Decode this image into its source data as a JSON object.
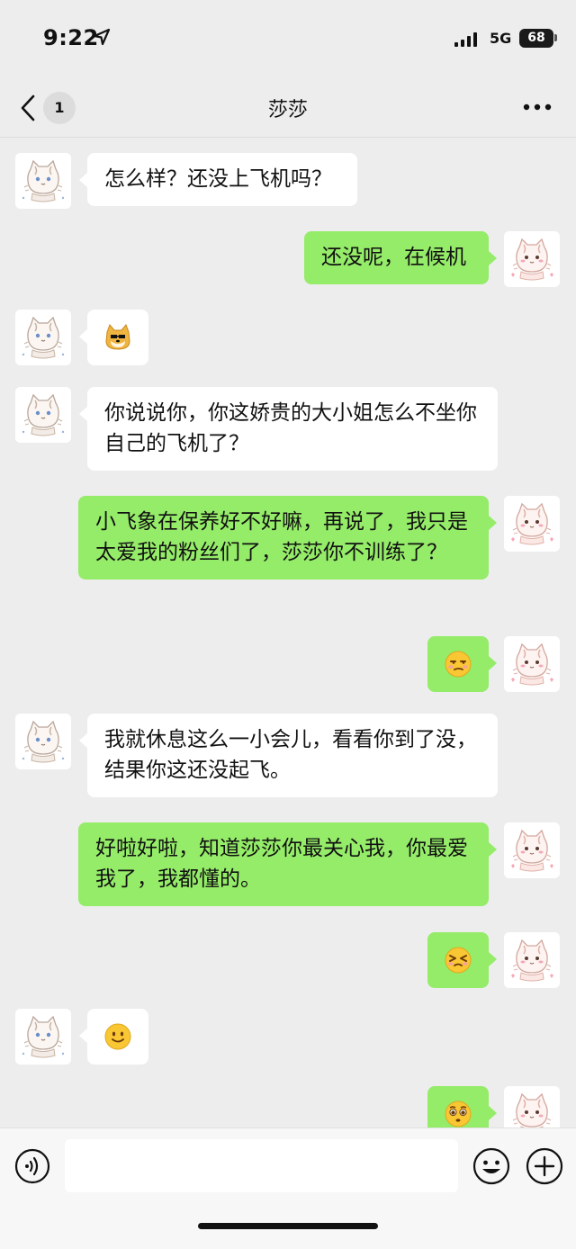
{
  "status_bar": {
    "time": "9:22",
    "network": "5G",
    "battery": "68"
  },
  "nav": {
    "unread_badge": "1",
    "title": "莎莎"
  },
  "messages": [
    {
      "side": "left",
      "type": "text",
      "text": "怎么样？还没上飞机吗？"
    },
    {
      "side": "right",
      "type": "text",
      "text": "还没呢，在候机"
    },
    {
      "side": "left",
      "type": "emoji",
      "emoji": "doge-emoji"
    },
    {
      "side": "left",
      "type": "text",
      "text": "你说说你，你这娇贵的大小姐怎么不坐你自己的飞机了？"
    },
    {
      "side": "right",
      "type": "text",
      "text": "小飞象在保养好不好嘛，再说了，我只是太爱我的粉丝们了，莎莎你不训练了？"
    },
    {
      "side": "right",
      "type": "emoji",
      "emoji": "smirk-emoji"
    },
    {
      "side": "left",
      "type": "text",
      "text": "我就休息这么一小会儿，看看你到了没，结果你这还没起飞。"
    },
    {
      "side": "right",
      "type": "text",
      "text": "好啦好啦，知道莎莎你最关心我，你最爱我了，我都懂的。"
    },
    {
      "side": "right",
      "type": "emoji",
      "emoji": "squint-emoji"
    },
    {
      "side": "left",
      "type": "emoji",
      "emoji": "smile-emoji"
    },
    {
      "side": "right",
      "type": "emoji",
      "emoji": "pleading-emoji"
    }
  ],
  "input": {
    "value": "",
    "placeholder": ""
  },
  "colors": {
    "background": "#ededed",
    "sent_bubble": "#95ec69",
    "received_bubble": "#ffffff"
  }
}
